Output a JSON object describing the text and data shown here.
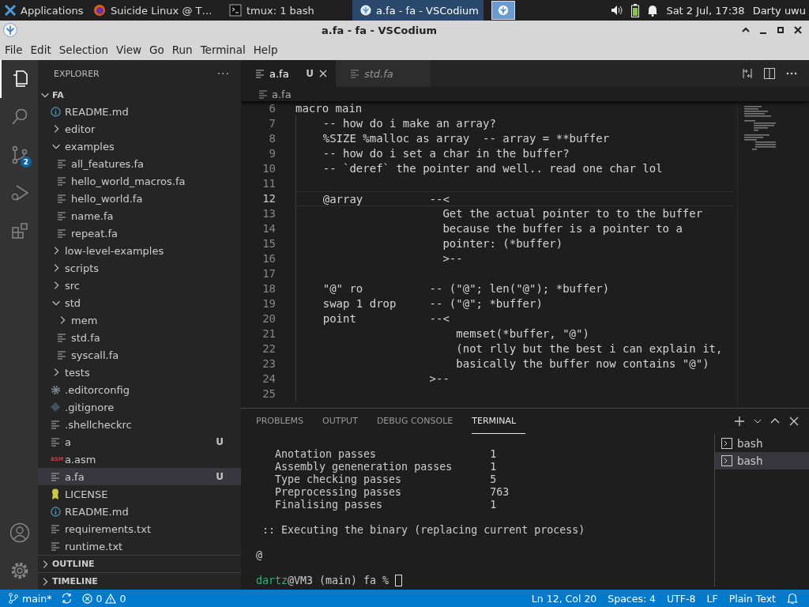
{
  "taskbar": {
    "items": [
      {
        "kind": "menu",
        "label": "Applications",
        "selected": false
      },
      {
        "kind": "browser",
        "label": "Suicide Linux @ T…",
        "selected": false
      },
      {
        "kind": "terminal",
        "label": "tmux: 1 bash",
        "selected": false
      },
      {
        "kind": "editor",
        "label": "a.fa - fa - VSCodium",
        "selected": true
      }
    ],
    "clock": "Sat  2 Jul, 17:38",
    "user": "Darty uwu"
  },
  "window": {
    "title": "a.fa - fa - VSCodium"
  },
  "menu": [
    "File",
    "Edit",
    "Selection",
    "View",
    "Go",
    "Run",
    "Terminal",
    "Help"
  ],
  "activity_bar": [
    {
      "kind": "explorer",
      "selected": true
    },
    {
      "kind": "search",
      "selected": false
    },
    {
      "kind": "source-control",
      "selected": false,
      "badge": "2"
    },
    {
      "kind": "run-debug",
      "selected": false
    },
    {
      "kind": "extensions",
      "selected": false
    }
  ],
  "explorer": {
    "title": "EXPLORER",
    "actions": "···",
    "root": {
      "label": "FA",
      "expanded": true
    },
    "tree": [
      {
        "kind": "info",
        "name": "README.md",
        "selected": false
      },
      {
        "kind": "folder",
        "name": "editor",
        "expanded": false,
        "selected": false
      },
      {
        "kind": "folder",
        "name": "examples",
        "expanded": true,
        "selected": false,
        "children": [
          {
            "kind": "text",
            "name": "all_features.fa",
            "selected": false
          },
          {
            "kind": "text",
            "name": "hello_world_macros.fa",
            "selected": false
          },
          {
            "kind": "text",
            "name": "hello_world.fa",
            "selected": false
          },
          {
            "kind": "text",
            "name": "name.fa",
            "selected": false
          },
          {
            "kind": "text",
            "name": "repeat.fa",
            "selected": false
          }
        ]
      },
      {
        "kind": "folder",
        "name": "low-level-examples",
        "expanded": false,
        "selected": false
      },
      {
        "kind": "folder",
        "name": "scripts",
        "expanded": false,
        "selected": false
      },
      {
        "kind": "folder",
        "name": "src",
        "expanded": false,
        "selected": false
      },
      {
        "kind": "folder",
        "name": "std",
        "expanded": true,
        "selected": false,
        "children": [
          {
            "kind": "folder",
            "name": "mem",
            "expanded": false,
            "selected": false
          },
          {
            "kind": "text",
            "name": "std.fa",
            "selected": false
          },
          {
            "kind": "text",
            "name": "syscall.fa",
            "selected": false
          }
        ]
      },
      {
        "kind": "folder",
        "name": "tests",
        "expanded": false,
        "selected": false
      },
      {
        "kind": "gear",
        "name": ".editorconfig",
        "selected": false
      },
      {
        "kind": "git",
        "name": ".gitignore",
        "selected": false
      },
      {
        "kind": "text",
        "name": ".shellcheckrc",
        "selected": false
      },
      {
        "kind": "text",
        "name": "a",
        "status": "U",
        "selected": false
      },
      {
        "kind": "asm",
        "icon_label": "ASM",
        "name": "a.asm",
        "selected": false
      },
      {
        "kind": "text",
        "name": "a.fa",
        "status": "U",
        "selected": true
      },
      {
        "kind": "license",
        "name": "LICENSE",
        "selected": false
      },
      {
        "kind": "info",
        "name": "README.md",
        "selected": false
      },
      {
        "kind": "text",
        "name": "requirements.txt",
        "selected": false
      },
      {
        "kind": "text",
        "name": "runtime.txt",
        "selected": false
      }
    ],
    "sections": [
      {
        "title": "OUTLINE",
        "expanded": false
      },
      {
        "title": "TIMELINE",
        "expanded": false
      }
    ]
  },
  "editor": {
    "tabs": [
      {
        "label": "a.fa",
        "selected": true,
        "preview": false,
        "status": "U"
      },
      {
        "label": "std.fa",
        "selected": false,
        "preview": true
      }
    ],
    "breadcrumb": "a.fa",
    "lines": [
      {
        "number": "6",
        "text": "macro main",
        "current": false
      },
      {
        "number": "7",
        "text": "    -- how do i make an array?",
        "current": false
      },
      {
        "number": "8",
        "text": "    %SIZE %malloc as array  -- array = **buffer",
        "current": false
      },
      {
        "number": "9",
        "text": "    -- how do i set a char in the buffer?",
        "current": false
      },
      {
        "number": "10",
        "text": "    -- `deref` the pointer and well.. read one char lol",
        "current": false
      },
      {
        "number": "11",
        "current": false
      },
      {
        "number": "12",
        "text": "    @array          --<",
        "current": true
      },
      {
        "number": "13",
        "text": "                      Get the actual pointer to to the buffer",
        "current": false
      },
      {
        "number": "14",
        "text": "                      because the buffer is a pointer to a",
        "current": false
      },
      {
        "number": "15",
        "text": "                      pointer: (*buffer)",
        "current": false
      },
      {
        "number": "16",
        "text": "                      >--",
        "current": false
      },
      {
        "number": "17",
        "current": false
      },
      {
        "number": "18",
        "text": "    \"@\" ro          -- (\"@\"; len(\"@\"); *buffer)",
        "current": false
      },
      {
        "number": "19",
        "text": "    swap 1 drop     -- (\"@\"; *buffer)",
        "current": false
      },
      {
        "number": "20",
        "text": "    point           --<",
        "current": false
      },
      {
        "number": "21",
        "text": "                        memset(*buffer, \"@\")",
        "current": false
      },
      {
        "number": "22",
        "text": "                        (not rlly but the best i can explain it,",
        "current": false
      },
      {
        "number": "23",
        "text": "                        basically the buffer now contains \"@\")",
        "current": false
      },
      {
        "number": "24",
        "text": "                    >--",
        "current": false
      },
      {
        "number": "25",
        "current": false
      }
    ]
  },
  "panel": {
    "tabs": [
      {
        "label": "PROBLEMS",
        "selected": false
      },
      {
        "label": "OUTPUT",
        "selected": false
      },
      {
        "label": "DEBUG CONSOLE",
        "selected": false
      },
      {
        "label": "TERMINAL",
        "selected": true
      }
    ],
    "terminal": [
      {
        "kind": "output",
        "text": "   Anotation passes                  1"
      },
      {
        "kind": "output",
        "text": "   Assembly geneneration passes      1"
      },
      {
        "kind": "output",
        "text": "   Type checking passes              5"
      },
      {
        "kind": "output",
        "text": "   Preprocessing passes              763"
      },
      {
        "kind": "output",
        "text": "   Finalising passes                 1"
      },
      {
        "kind": "blank"
      },
      {
        "kind": "output",
        "text": " :: Executing the binary (replacing current process)"
      },
      {
        "kind": "blank"
      },
      {
        "kind": "output",
        "text": "@"
      },
      {
        "kind": "blank"
      },
      {
        "kind": "prompt",
        "user": "dartz",
        "text": "@VM3 (main) fa % "
      }
    ],
    "instances": [
      {
        "label": "bash",
        "selected": false
      },
      {
        "label": "bash",
        "selected": true
      }
    ]
  },
  "status_bar": {
    "branch": "main*",
    "errors": "0",
    "warnings": "0",
    "items": [
      "Ln 12, Col 20",
      "Spaces: 4",
      "UTF-8",
      "LF",
      "Plain Text"
    ]
  }
}
